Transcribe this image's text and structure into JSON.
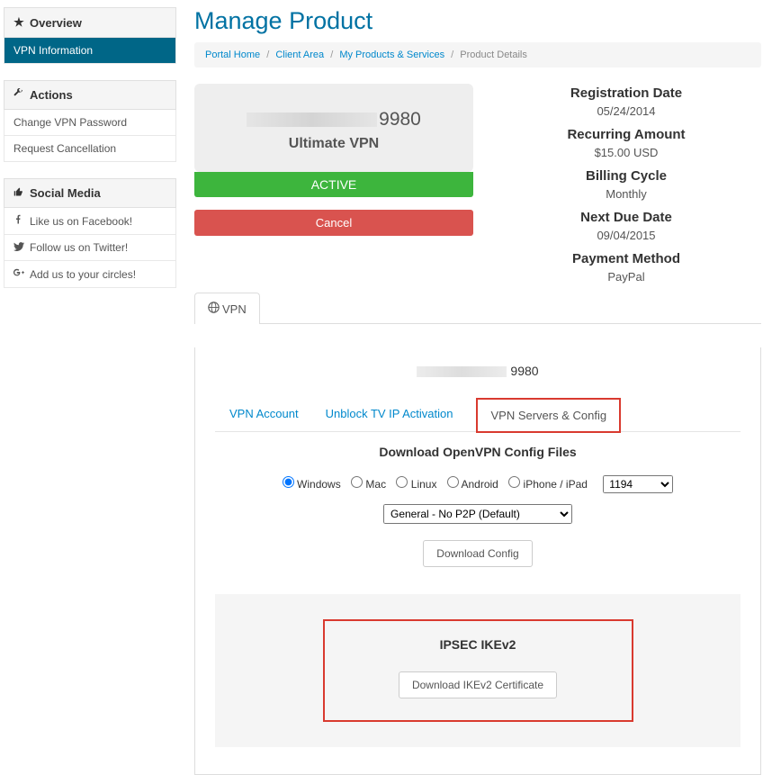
{
  "sidebar": {
    "overview": {
      "title": "Overview",
      "items": [
        {
          "label": "VPN Information"
        }
      ]
    },
    "actions": {
      "title": "Actions",
      "items": [
        {
          "label": "Change VPN Password"
        },
        {
          "label": "Request Cancellation"
        }
      ]
    },
    "social": {
      "title": "Social Media",
      "items": [
        {
          "label": "Like us on Facebook!"
        },
        {
          "label": "Follow us on Twitter!"
        },
        {
          "label": "Add us to your circles!"
        }
      ]
    }
  },
  "page": {
    "title": "Manage Product"
  },
  "breadcrumb": {
    "portal": "Portal Home",
    "client": "Client Area",
    "products": "My Products & Services",
    "current": "Product Details"
  },
  "product": {
    "id_suffix": "9980",
    "name": "Ultimate VPN",
    "status": "ACTIVE",
    "cancel": "Cancel"
  },
  "billing": {
    "reg_label": "Registration Date",
    "reg_value": "05/24/2014",
    "recurring_label": "Recurring Amount",
    "recurring_value": "$15.00 USD",
    "cycle_label": "Billing Cycle",
    "cycle_value": "Monthly",
    "due_label": "Next Due Date",
    "due_value": "09/04/2015",
    "payment_label": "Payment Method",
    "payment_value": "PayPal"
  },
  "tabs": {
    "vpn": "VPN"
  },
  "vpn_panel": {
    "account_suffix": "9980",
    "inner_tabs": {
      "account": "VPN Account",
      "unblock": "Unblock TV IP Activation",
      "servers": "VPN Servers & Config"
    },
    "download_title": "Download OpenVPN Config Files",
    "os": {
      "windows": "Windows",
      "mac": "Mac",
      "linux": "Linux",
      "android": "Android",
      "iphone": "iPhone / iPad"
    },
    "port": "1194",
    "server_select": "General - No P2P (Default)",
    "download_btn": "Download Config",
    "ipsec": {
      "title": "IPSEC IKEv2",
      "btn": "Download IKEv2 Certificate"
    }
  }
}
